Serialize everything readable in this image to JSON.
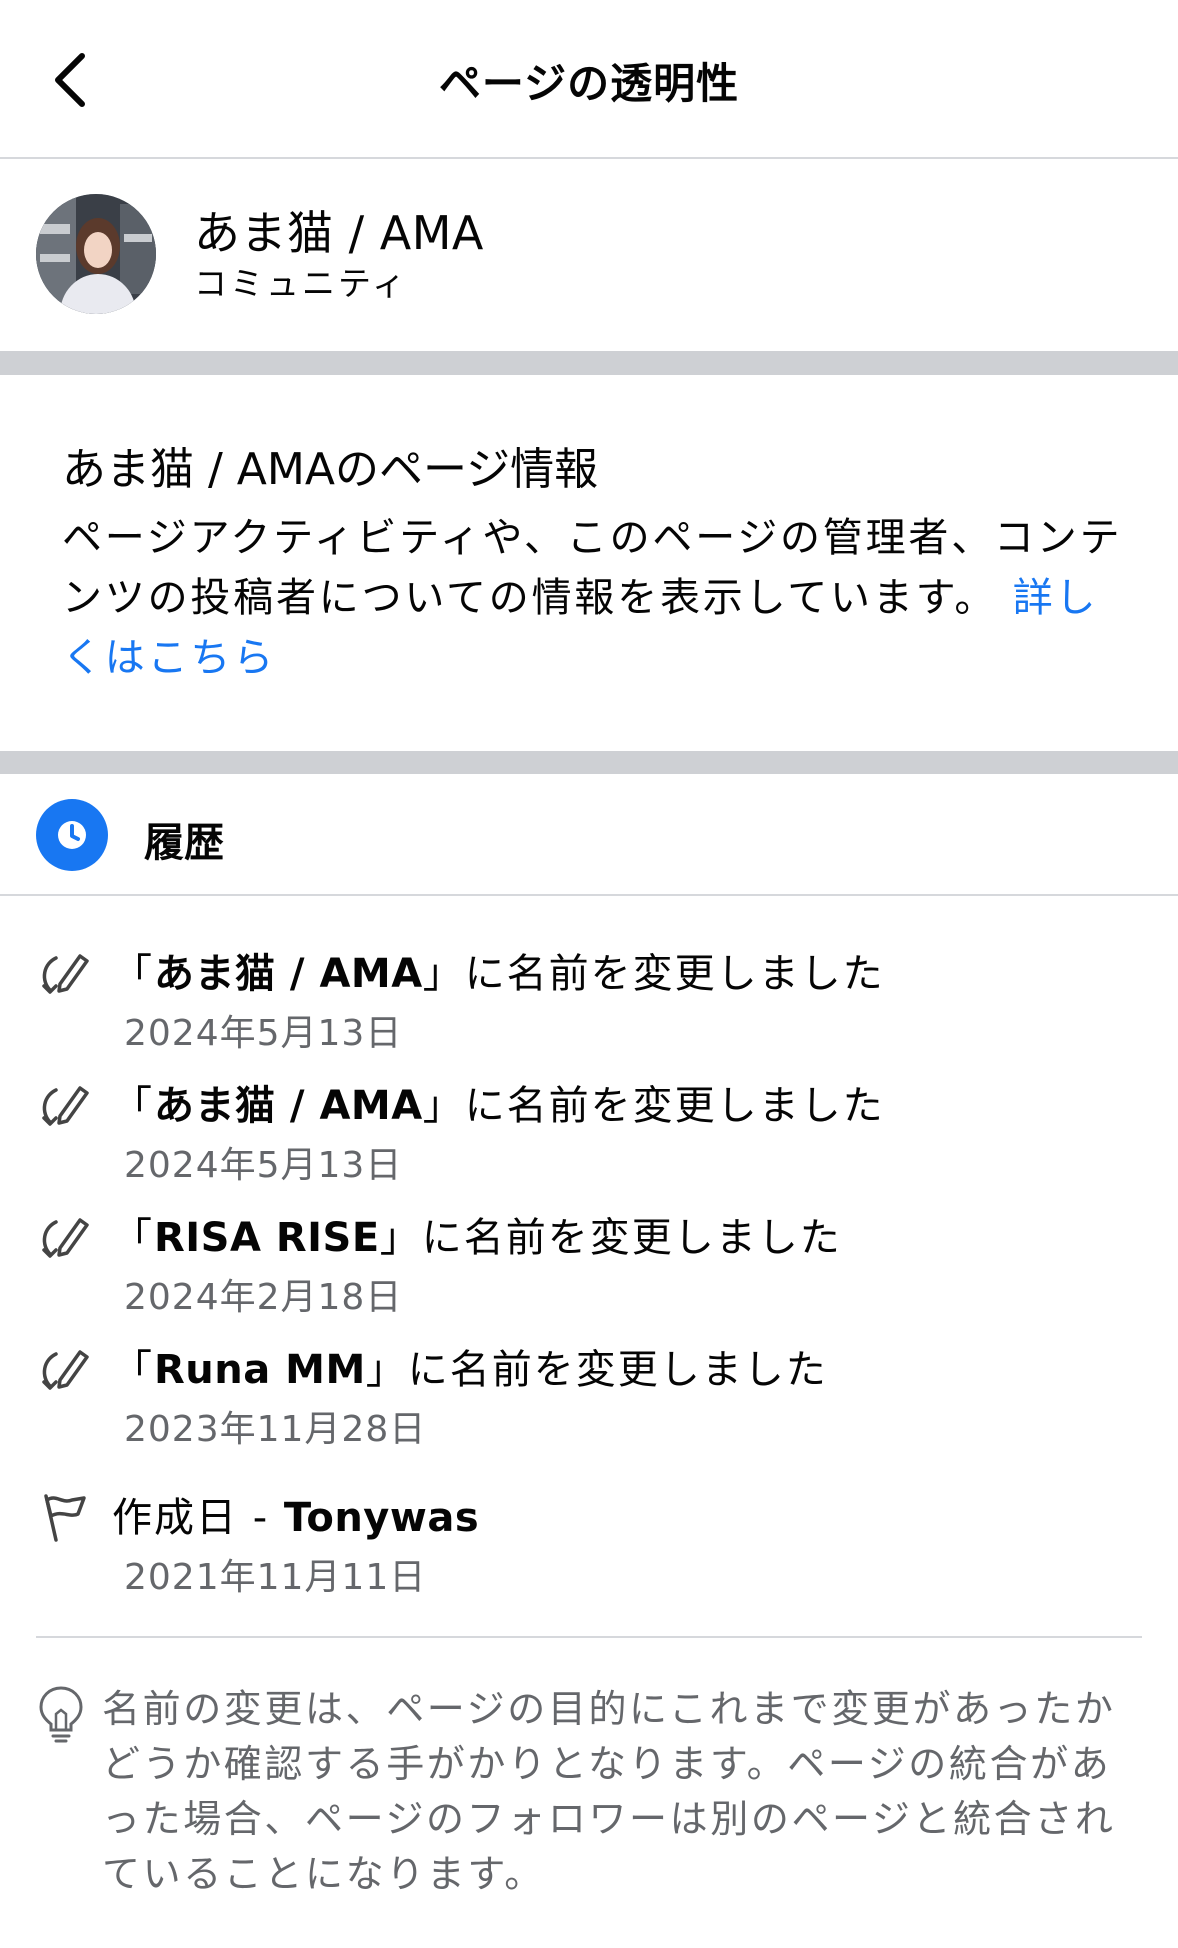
{
  "header": {
    "title": "ページの透明性",
    "back_icon": "chevron-left-icon"
  },
  "profile": {
    "name": "あま猫 / AMA",
    "category": "コミュニティ"
  },
  "page_info": {
    "title": "あま猫 / AMAのページ情報",
    "description": "ページアクティビティや、このページの管理者、コンテンツの投稿者についての情報を表示しています。",
    "link_label": "詳しくはこちら"
  },
  "history": {
    "title": "履歴",
    "icon": "clock-icon",
    "entries": [
      {
        "open": "「",
        "name": "あま猫 / AMA",
        "close": "」",
        "suffix": "に名前を変更しました",
        "date": "2024年5月13日",
        "icon": "rename-icon"
      },
      {
        "open": "「",
        "name": "あま猫 / AMA",
        "close": "」",
        "suffix": "に名前を変更しました",
        "date": "2024年5月13日",
        "icon": "rename-icon"
      },
      {
        "open": "「",
        "name": "RISA RISE",
        "close": "」",
        "suffix": "に名前を変更しました",
        "date": "2024年2月18日",
        "icon": "rename-icon"
      },
      {
        "open": "「",
        "name": "Runa MM",
        "close": "」",
        "suffix": "に名前を変更しました",
        "date": "2023年11月28日",
        "icon": "rename-icon"
      }
    ],
    "created": {
      "prefix": "作成日 - ",
      "name": "Tonywas",
      "date": "2021年11月11日",
      "icon": "flag-icon"
    }
  },
  "note": {
    "icon": "lightbulb-icon",
    "text": "名前の変更は、ページの目的にこれまで変更があったかどうか確認する手がかりとなります。ページの統合があった場合、ページのフォロワーは別のページと統合されていることになります。"
  },
  "colors": {
    "accent": "#1877f2",
    "secondary_text": "#65676b",
    "separator": "#ced0d4"
  }
}
